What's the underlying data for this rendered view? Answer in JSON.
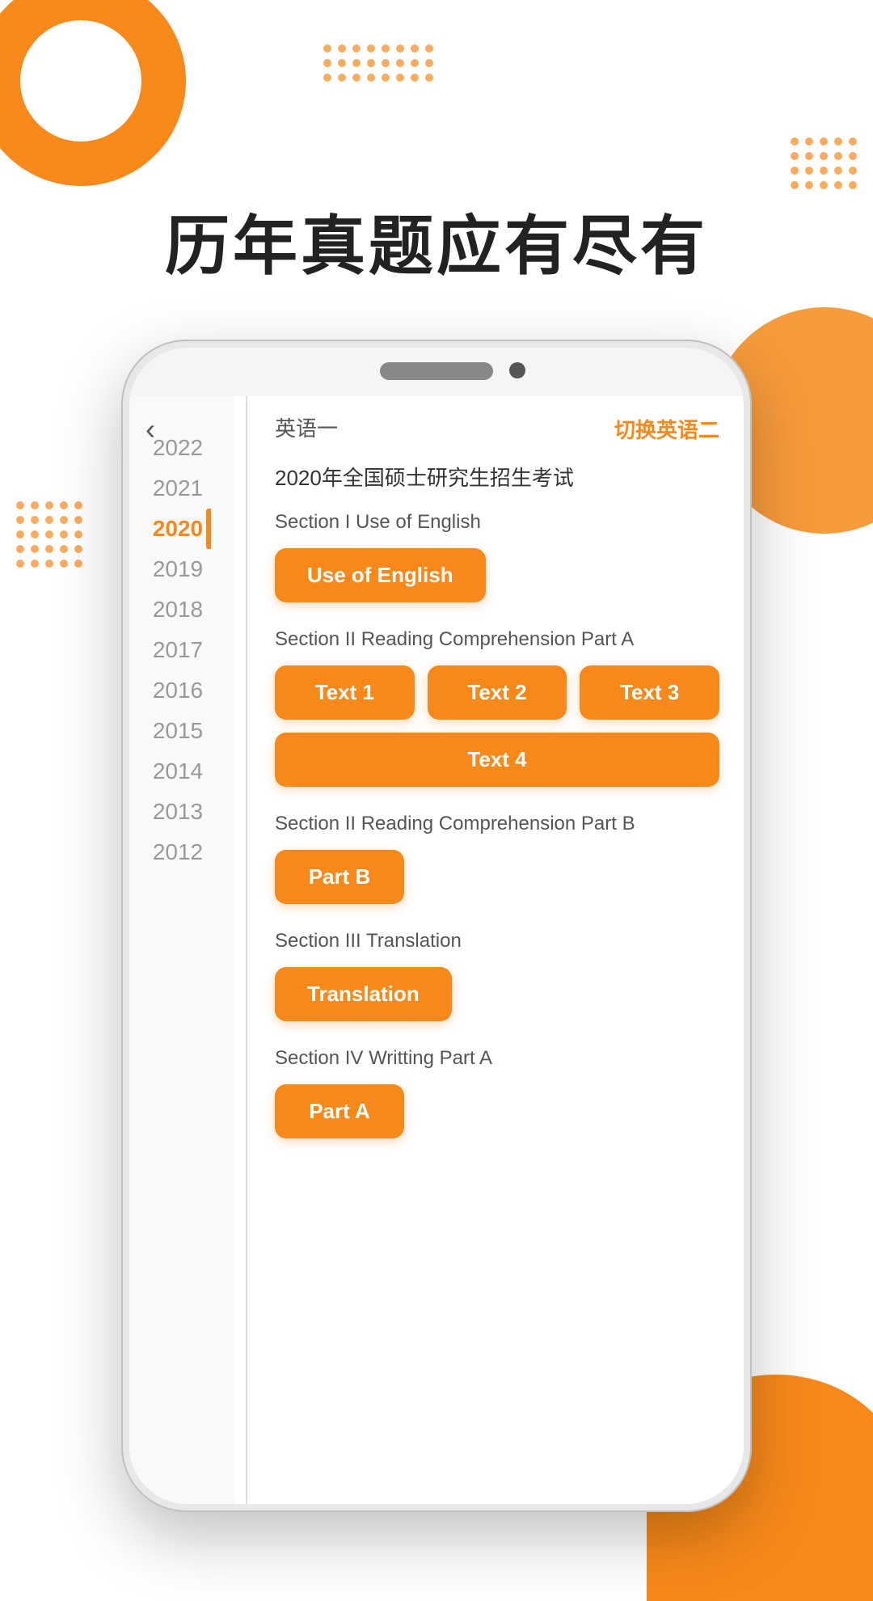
{
  "page": {
    "main_title": "历年真题应有尽有"
  },
  "phone": {
    "header": {
      "lang_label": "英语一",
      "switch_label": "切换英语二",
      "exam_title": "2020年全国硕士研究生招生考试"
    },
    "years": [
      {
        "year": "2022",
        "active": false
      },
      {
        "year": "2021",
        "active": false
      },
      {
        "year": "2020",
        "active": true
      },
      {
        "year": "2019",
        "active": false
      },
      {
        "year": "2018",
        "active": false
      },
      {
        "year": "2017",
        "active": false
      },
      {
        "year": "2016",
        "active": false
      },
      {
        "year": "2015",
        "active": false
      },
      {
        "year": "2014",
        "active": false
      },
      {
        "year": "2013",
        "active": false
      },
      {
        "year": "2012",
        "active": false
      }
    ],
    "sections": [
      {
        "title": "Section I Use of English",
        "buttons": [
          {
            "label": "Use of English",
            "wide": true
          }
        ]
      },
      {
        "title": "Section II Reading Comprehension Part A",
        "buttons": [
          {
            "label": "Text 1"
          },
          {
            "label": "Text 2"
          },
          {
            "label": "Text 3"
          },
          {
            "label": "Text 4"
          }
        ]
      },
      {
        "title": "Section II Reading Comprehension Part B",
        "buttons": [
          {
            "label": "Part B",
            "wide": true
          }
        ]
      },
      {
        "title": "Section III Translation",
        "buttons": [
          {
            "label": "Translation",
            "wide": true
          }
        ]
      },
      {
        "title": "Section IV Writting Part A",
        "buttons": [
          {
            "label": "Part A",
            "wide": true
          }
        ]
      }
    ]
  },
  "decorations": {
    "dots_top_cols": 8,
    "dots_top_rows": 3,
    "dots_right_cols": 5,
    "dots_right_rows": 4,
    "dots_left_cols": 5,
    "dots_left_rows": 5
  }
}
